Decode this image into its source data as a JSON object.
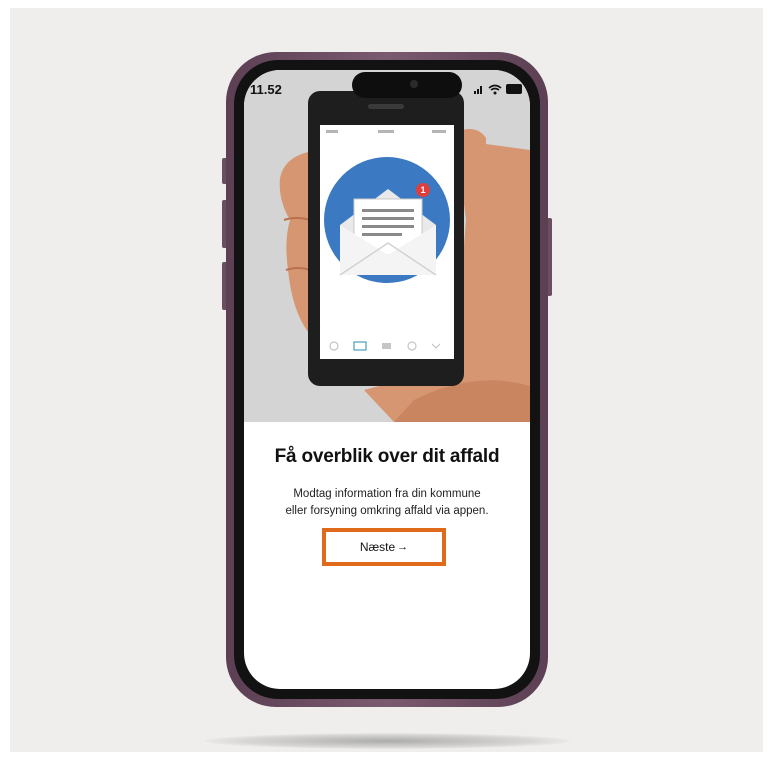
{
  "status_bar": {
    "time": "11.52",
    "icons": [
      "signal-icon",
      "wifi-icon",
      "battery-icon"
    ]
  },
  "illustration": {
    "notification_count": "1"
  },
  "onboarding": {
    "title": "Få overblik over dit affald",
    "description_line1": "Modtag information fra din kommune",
    "description_line2": "eller forsyning omkring affald via appen.",
    "next_label": "Næste",
    "next_arrow": "→"
  },
  "colors": {
    "accent_highlight": "#e06a1b",
    "mail_circle": "#3b7ac2",
    "badge": "#e23d3d",
    "phone_frame": "#6b4d60"
  }
}
